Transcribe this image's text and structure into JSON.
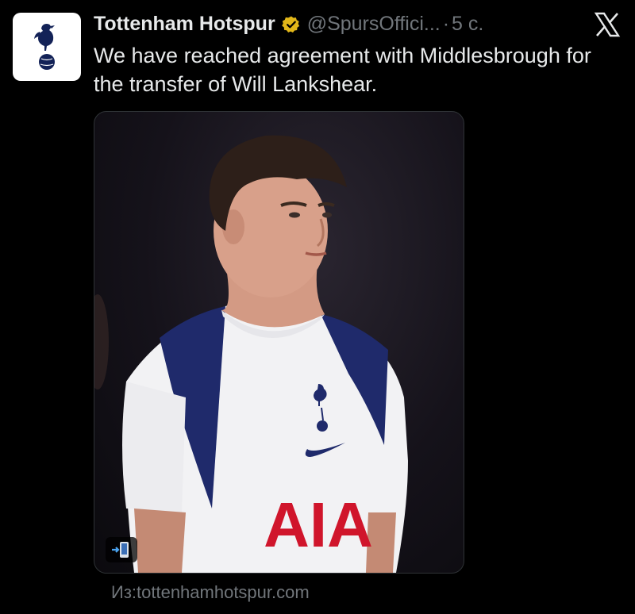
{
  "tweet": {
    "display_name": "Tottenham Hotspur",
    "handle": "@SpursOffici...",
    "separator": "·",
    "time": "5 с.",
    "text": "We have reached agreement with Middlesbrough for the transfer of Will Lankshear.",
    "source": "Из:tottenhamhotspur.com",
    "avatar_icon": "spurs-crest-icon",
    "verified_icon": "gold-verified-badge-icon",
    "platform_icon": "x-logo-icon"
  },
  "media": {
    "shirt_sponsor": "AIA",
    "badge_icon": "phone-arrow-icon"
  },
  "colors": {
    "background": "#000000",
    "text": "#e7e9ea",
    "secondary": "#71767b",
    "verified_gold": "#e2b719",
    "spurs_navy": "#132257",
    "sponsor_red": "#d0152b"
  }
}
